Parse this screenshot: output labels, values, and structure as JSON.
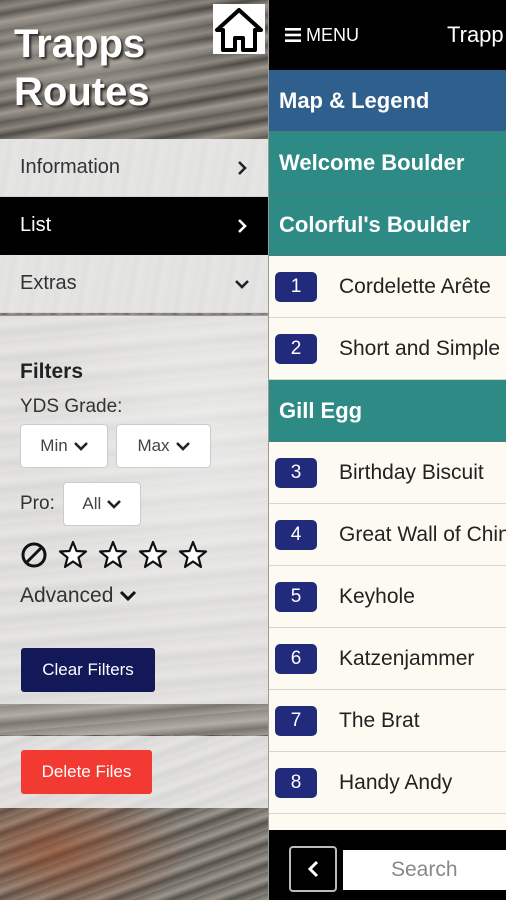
{
  "drawer": {
    "title_line1": "Trapps",
    "title_line2": "Routes",
    "home_icon": "home-icon",
    "menu": [
      {
        "label": "Information",
        "chevron": "chevron-right"
      },
      {
        "label": "List",
        "chevron": "chevron-right",
        "active": true
      },
      {
        "label": "Extras",
        "chevron": "chevron-down"
      }
    ],
    "filters": {
      "title": "Filters",
      "grade_label": "YDS Grade:",
      "min_label": "Min",
      "max_label": "Max",
      "pro_label": "Pro:",
      "pro_value": "All",
      "stars": 0,
      "advanced_label": "Advanced",
      "clear_label": "Clear Filters"
    },
    "delete_label": "Delete Files"
  },
  "main": {
    "menu_label": "MENU",
    "title": "Trapp",
    "sections": [
      {
        "type": "section",
        "label": "Map & Legend",
        "color": "#2f5f8c"
      },
      {
        "type": "section",
        "label": "Welcome Boulder",
        "color": "#2e8a85"
      },
      {
        "type": "section",
        "label": "Colorful's Boulder",
        "color": "#2e8a85"
      },
      {
        "type": "route",
        "num": "1",
        "name": "Cordelette Arête"
      },
      {
        "type": "route",
        "num": "2",
        "name": "Short and Simple"
      },
      {
        "type": "section",
        "label": "Gill Egg",
        "color": "#2e8a85"
      },
      {
        "type": "route",
        "num": "3",
        "name": "Birthday Biscuit"
      },
      {
        "type": "route",
        "num": "4",
        "name": "Great Wall of China"
      },
      {
        "type": "route",
        "num": "5",
        "name": "Keyhole"
      },
      {
        "type": "route",
        "num": "6",
        "name": "Katzenjammer"
      },
      {
        "type": "route",
        "num": "7",
        "name": "The Brat"
      },
      {
        "type": "route",
        "num": "8",
        "name": "Handy Andy"
      }
    ],
    "search_placeholder": "Search"
  },
  "colors": {
    "section_blue": "#2f5f8c",
    "section_teal": "#2e8a85",
    "route_badge": "#222a7c",
    "clear_button": "#121858",
    "delete_button": "#f23a33"
  }
}
